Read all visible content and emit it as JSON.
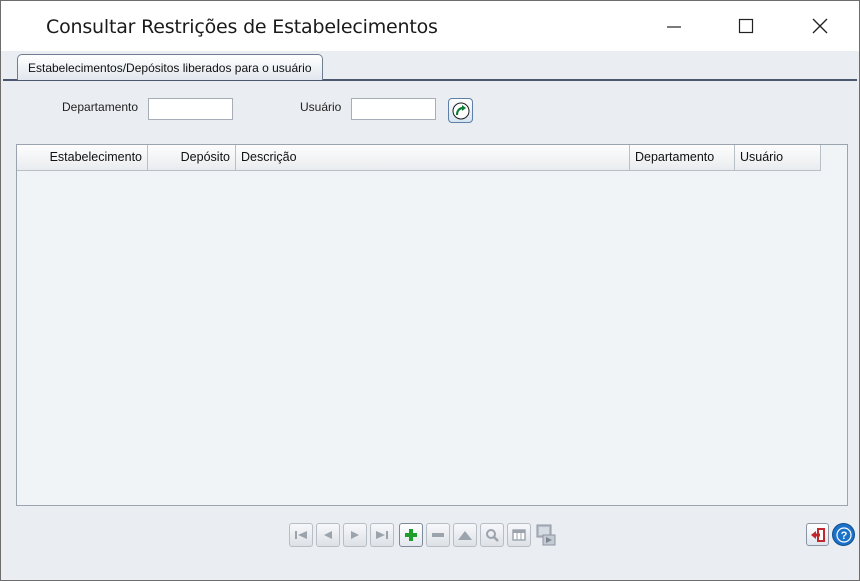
{
  "window": {
    "title": "Consultar Restrições de Estabelecimentos",
    "controls": {
      "minimize": "minimize-icon",
      "maximize": "maximize-icon",
      "close": "close-icon"
    }
  },
  "tabs": [
    {
      "label": "Estabelecimentos/Depósitos liberados para o usuário",
      "active": true
    }
  ],
  "filters": {
    "departamento_label": "Departamento",
    "departamento_value": "",
    "usuario_label": "Usuário",
    "usuario_value": "",
    "go_button_icon": "refresh-arrow-icon"
  },
  "table": {
    "columns": [
      "Estabelecimento",
      "Depósito",
      "Descrição",
      "Departamento",
      "Usuário"
    ],
    "rows": []
  },
  "navigator": {
    "buttons": [
      {
        "name": "first-record",
        "icon": "first-icon",
        "enabled": false
      },
      {
        "name": "prior-record",
        "icon": "prev-icon",
        "enabled": false
      },
      {
        "name": "next-record",
        "icon": "next-icon",
        "enabled": false
      },
      {
        "name": "last-record",
        "icon": "last-icon",
        "enabled": false
      },
      {
        "name": "insert-record",
        "icon": "plus-icon",
        "enabled": true
      },
      {
        "name": "delete-record",
        "icon": "minus-icon",
        "enabled": false
      },
      {
        "name": "edit-record",
        "icon": "triangle-up-icon",
        "enabled": false
      },
      {
        "name": "search-record",
        "icon": "magnifier-icon",
        "enabled": false
      },
      {
        "name": "columns-record",
        "icon": "grid-icon",
        "enabled": false
      },
      {
        "name": "export-record",
        "icon": "export-icon",
        "enabled": false
      }
    ]
  },
  "footer": {
    "exit_icon": "exit-icon",
    "help_icon": "help-icon"
  },
  "colors": {
    "accent": "#4b5870",
    "plus": "#1f9e2c",
    "exit": "#c2272d",
    "help": "#1b72c8"
  }
}
